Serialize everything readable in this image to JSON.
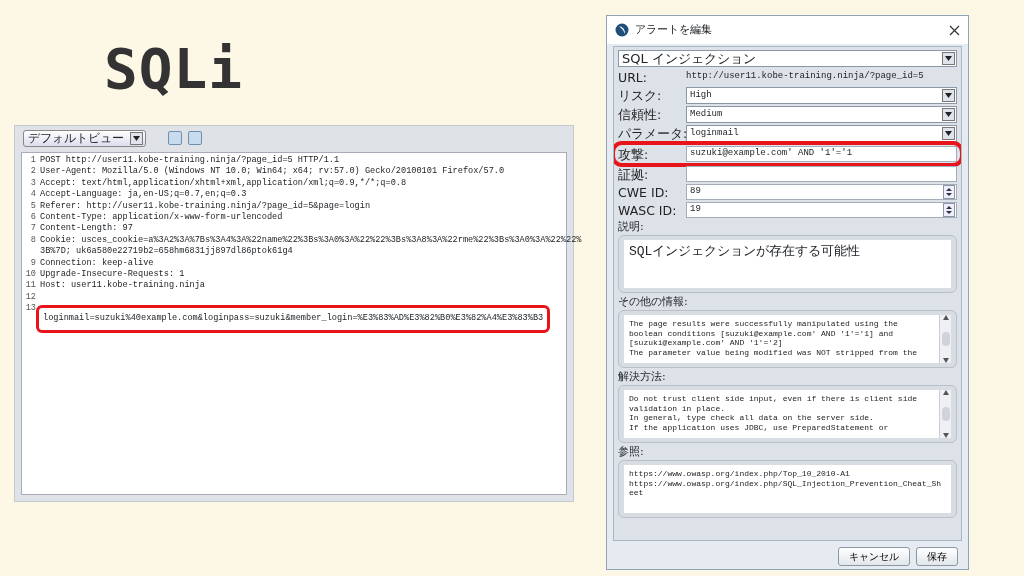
{
  "slide": {
    "title": "SQLi"
  },
  "request_panel": {
    "view_select": "デフォルトビュー",
    "lines": [
      {
        "number": "1",
        "text": "POST http://user11.kobe-training.ninja/?page_id=5 HTTP/1.1"
      },
      {
        "number": "2",
        "text": "User-Agent: Mozilla/5.0 (Windows NT 10.0; Win64; x64; rv:57.0) Gecko/20100101 Firefox/57.0"
      },
      {
        "number": "3",
        "text": "Accept: text/html,application/xhtml+xml,application/xml;q=0.9,*/*;q=0.8"
      },
      {
        "number": "4",
        "text": "Accept-Language: ja,en-US;q=0.7,en;q=0.3"
      },
      {
        "number": "5",
        "text": "Referer: http://user11.kobe-training.ninja/?page_id=5&page=login"
      },
      {
        "number": "6",
        "text": "Content-Type: application/x-www-form-urlencoded"
      },
      {
        "number": "7",
        "text": "Content-Length: 97"
      },
      {
        "number": "8",
        "text": "Cookie: usces_cookie=a%3A2%3A%7Bs%3A4%3A%22name%22%3Bs%3A0%3A%22%22%3Bs%3A8%3A%22rme%22%3Bs%3A0%3A%22%22%",
        "wrap": "3B%7D; uk6a580e22719b2=658hm6831jj897dl86ptok61g4"
      },
      {
        "number": "9",
        "text": "Connection: keep-alive"
      },
      {
        "number": "10",
        "text": "Upgrade-Insecure-Requests: 1"
      },
      {
        "number": "11",
        "text": "Host: user11.kobe-training.ninja"
      },
      {
        "number": "12"
      },
      {
        "number": "13",
        "text": "loginmail=suzuki%40example.com&loginpass=suzuki&member_login=%E3%83%AD%E3%82%B0%E3%82%A4%E3%83%B3",
        "highlighted": true
      }
    ]
  },
  "dialog": {
    "title": "アラートを編集",
    "alert_select": "SQL インジェクション",
    "fields": [
      {
        "kind": "text",
        "label": "URL:",
        "value": "http://user11.kobe-training.ninja/?page_id=5"
      },
      {
        "kind": "select",
        "label": "リスク:",
        "value": "High"
      },
      {
        "kind": "select",
        "label": "信頼性:",
        "value": "Medium"
      },
      {
        "kind": "select",
        "label": "パラメータ:",
        "value": "loginmail"
      },
      {
        "kind": "input",
        "label": "攻撃:",
        "value": "suzuki@example.com' AND '1'='1",
        "highlighted": true
      },
      {
        "kind": "input",
        "label": "証拠:"
      },
      {
        "kind": "spinner",
        "label": "CWE ID:",
        "value": "89"
      },
      {
        "kind": "spinner",
        "label": "WASC ID:",
        "value": "19"
      }
    ],
    "sections": [
      {
        "label": "説明:",
        "lines": [
          "SQLインジェクションが存在する可能性"
        ],
        "scrollbar": false
      },
      {
        "label": "その他の情報:",
        "lines": [
          "The page results were successfully manipulated using the",
          "boolean conditions [suzuki@example.com' AND '1'='1] and",
          "[suzuki@example.com' AND '1'='2]",
          "The parameter value being modified was NOT stripped from the"
        ],
        "scrollbar": true
      },
      {
        "label": "解決方法:",
        "lines": [
          "Do not trust client side input, even if there is client side",
          "validation in place.",
          "In general, type check all data on the server side.",
          "If the application uses JDBC, use PreparedStatement or"
        ],
        "scrollbar": true
      },
      {
        "label": "参照:",
        "lines": [
          "https://www.owasp.org/index.php/Top_10_2010-A1",
          "https://www.owasp.org/index.php/SQL_Injection_Prevention_Cheat_Sh",
          "eet"
        ],
        "scrollbar": false
      }
    ],
    "buttons": [
      "キャンセル",
      "保存"
    ]
  }
}
